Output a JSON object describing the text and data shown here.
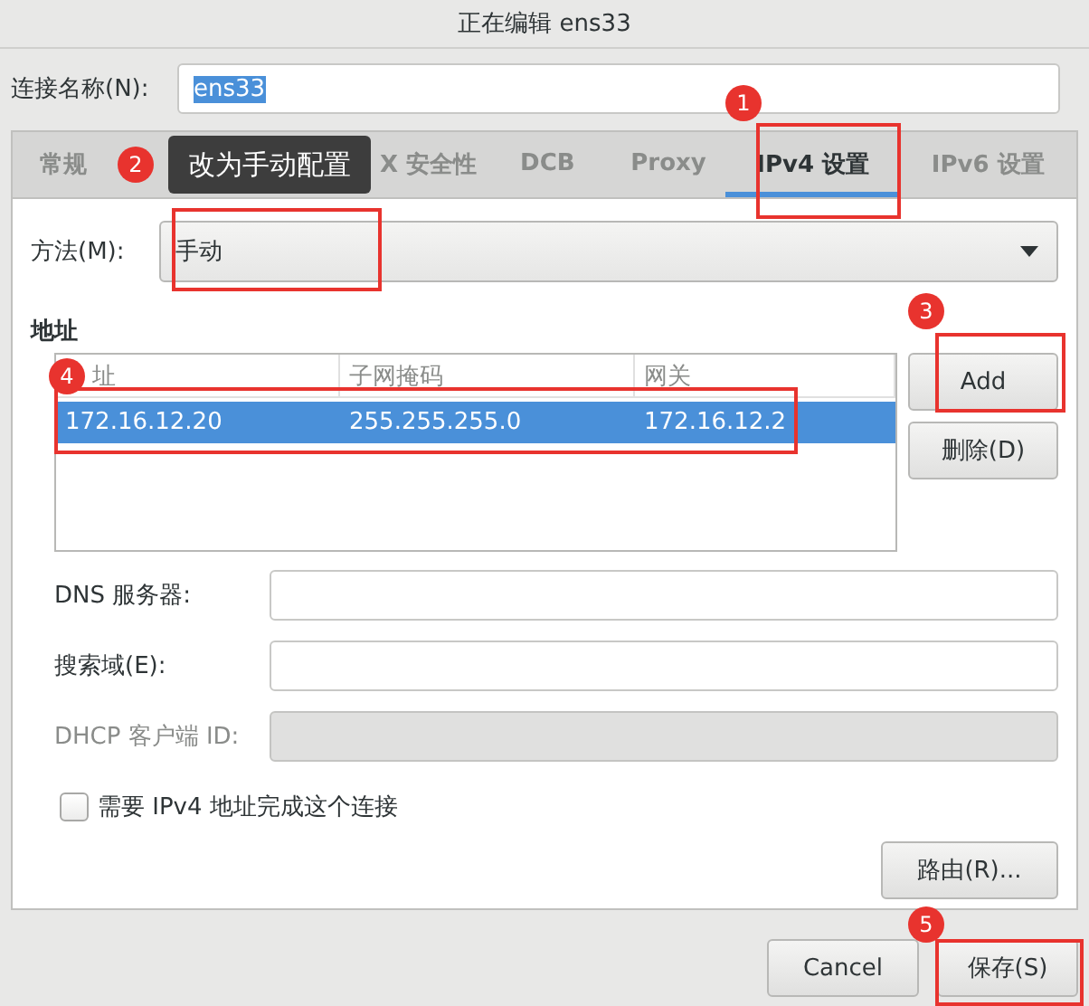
{
  "window": {
    "title": "正在编辑 ens33"
  },
  "connection_name": {
    "label": "连接名称(N):",
    "value": "ens33",
    "text_selected": true
  },
  "tabs": [
    {
      "label": "常规",
      "selected": false
    },
    {
      "label": "X 安全性",
      "selected": false
    },
    {
      "label": "DCB",
      "selected": false
    },
    {
      "label": "Proxy",
      "selected": false
    },
    {
      "label": "IPv4 设置",
      "selected": true
    },
    {
      "label": "IPv6 设置",
      "selected": false
    }
  ],
  "method": {
    "label": "方法(M):",
    "value": "手动"
  },
  "addresses": {
    "heading": "地址",
    "columns": [
      "址",
      "子网掩码",
      "网关"
    ],
    "rows": [
      {
        "cells": [
          "172.16.12.20",
          "255.255.255.0",
          "172.16.12.2"
        ],
        "selected": true
      }
    ],
    "buttons": [
      "Add",
      "删除(D)"
    ]
  },
  "fields": [
    {
      "label": "DNS 服务器:",
      "disabled": false
    },
    {
      "label": "搜索域(E):",
      "disabled": false
    },
    {
      "label": "DHCP 客户端 ID:",
      "disabled": true
    }
  ],
  "checkbox": {
    "label": "需要 IPv4 地址完成这个连接",
    "checked": false
  },
  "routes_button": "路由(R)...",
  "dialog_buttons": [
    "Cancel",
    "保存(S)"
  ],
  "annotations": {
    "tooltip": "改为手动配置",
    "markers": [
      {
        "number": "1"
      },
      {
        "number": "2"
      },
      {
        "number": "3"
      },
      {
        "number": "4"
      },
      {
        "number": "5"
      }
    ]
  }
}
